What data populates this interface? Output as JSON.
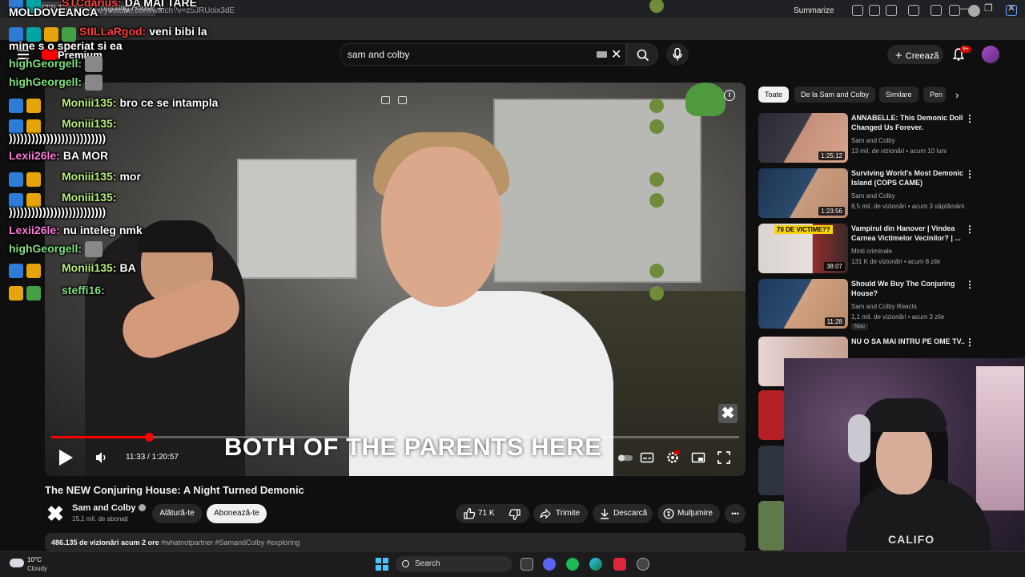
{
  "browser": {
    "tab_title": "(72) The NEW Conjuring House",
    "tab_close": "×",
    "new_tab": "+",
    "url": "https://www.youtube.com/watch?v=z5JRUoix3dE",
    "summarize_label": "Summarize",
    "window_controls": [
      "—",
      "❐",
      "✕"
    ]
  },
  "youtube": {
    "logo_text": "Premium",
    "search_value": "sam and colby",
    "create_label": "Creează",
    "notification_count": "9+"
  },
  "player": {
    "caption": "BOTH OF THE PARENTS HERE",
    "time": "11:33 / 1:20:57",
    "progress": 0.1425,
    "info_label": "i",
    "close_label": "✖"
  },
  "video": {
    "title": "The NEW Conjuring House: A Night Turned Demonic",
    "channel_logo": "✖",
    "channel_name": "Sam and Colby",
    "subscribers": "15,1 mil. de abonați",
    "join_label": "Alătură-te",
    "subscribe_label": "Abonează-te",
    "likes": "71 K",
    "share_label": "Trimite",
    "download_label": "Descarcă",
    "thanks_label": "Mulțumire",
    "more_label": "•••",
    "views": "486.135 de vizionări",
    "age": "acum 2 ore",
    "hashtags": "#whatnotpartner #SamandColby #exploring"
  },
  "sidebar": {
    "chips": [
      "Toate",
      "De la Sam and Colby",
      "Similare",
      "Pen"
    ],
    "chip_next": "›",
    "recommendations": [
      {
        "title": "ANNABELLE: This Demonic Doll Changed Us Forever.",
        "channel": "Sam and Colby",
        "meta": "13 mil. de vizionări • acum 10 luni",
        "duration": "1:25:12",
        "thumb_colors": [
          "#2a2a33",
          "#c58f7a"
        ]
      },
      {
        "title": "Surviving World's Most Demonic Island (COPS CAME)",
        "channel": "Sam and Colby",
        "meta": "8,5 mil. de vizionări • acum 3 săptămâni",
        "duration": "1:23:56",
        "thumb_colors": [
          "#2c4a6b",
          "#c99b7e"
        ]
      },
      {
        "title": "Vampirul din Hanover | Vindea Carnea Victimelor Vecinilor? | ...",
        "channel": "Minti criminale",
        "meta": "131 K de vizionări • acum 8 zile",
        "duration": "38:07",
        "thumb_label": "70 DE VICTIME??",
        "thumb_colors": [
          "#d9d4d0",
          "#8f2d2d"
        ]
      },
      {
        "title": "Should We Buy The Conjuring House?",
        "channel": "Sam and Colby Reacts",
        "meta": "1,1 mil. de vizionări • acum 3 zile",
        "duration": "11:28",
        "badge": "Nou",
        "thumb_colors": [
          "#1e3a5c",
          "#d1a27f"
        ]
      },
      {
        "title": "NU O SA MAI INTRU PE OME TV..",
        "channel": "",
        "meta": "",
        "duration": "",
        "thumb_colors": [
          "#e8d5d5",
          "#c8a090"
        ]
      }
    ]
  },
  "webcam": {
    "shirt_text": "CALIFO"
  },
  "chat": {
    "messages": [
      {
        "user": "STCdarius:",
        "text": "DA MAI TARE",
        "color": "#ff4444"
      },
      {
        "user": "",
        "text": "MOLDOVEANCA",
        "color": "#ffffff"
      },
      {
        "user": "StILLaRgod:",
        "text": "veni bibi la",
        "color": "#ff3b3b"
      },
      {
        "user": "",
        "text": "mine s o speriat si ea",
        "color": "#ffffff"
      },
      {
        "user": "highGeorgell:",
        "text": "",
        "color": "#7ee07e"
      },
      {
        "user": "highGeorgell:",
        "text": "",
        "color": "#7ee07e"
      },
      {
        "user": "Moniii135:",
        "text": "bro ce se intampla",
        "color": "#b8f07a"
      },
      {
        "user": "Moniii135:",
        "text": "",
        "color": "#b8f07a"
      },
      {
        "user": "",
        "text": "))))))))))))))))))))))))))",
        "color": "#ffffff"
      },
      {
        "user": "Lexii26le:",
        "text": "BA MOR",
        "color": "#ff7ad9"
      },
      {
        "user": "Moniii135:",
        "text": "mor",
        "color": "#b8f07a"
      },
      {
        "user": "Moniii135:",
        "text": "",
        "color": "#b8f07a"
      },
      {
        "user": "",
        "text": "))))))))))))))))))))))))))",
        "color": "#ffffff"
      },
      {
        "user": "Lexii26le:",
        "text": "nu inteleg nmk",
        "color": "#ff7ad9"
      },
      {
        "user": "highGeorgell:",
        "text": "",
        "color": "#7ee07e"
      },
      {
        "user": "Moniii135:",
        "text": "BA",
        "color": "#b8f07a"
      },
      {
        "user": "steffi16:",
        "text": "",
        "color": "#7ee07e"
      }
    ],
    "badge_number": "1"
  },
  "taskbar": {
    "temperature": "10°C",
    "weather": "Cloudy",
    "search_label": "Search"
  },
  "colors": {
    "youtube_red": "#ff0000",
    "background": "#0f0f0f",
    "pill": "#272727"
  }
}
